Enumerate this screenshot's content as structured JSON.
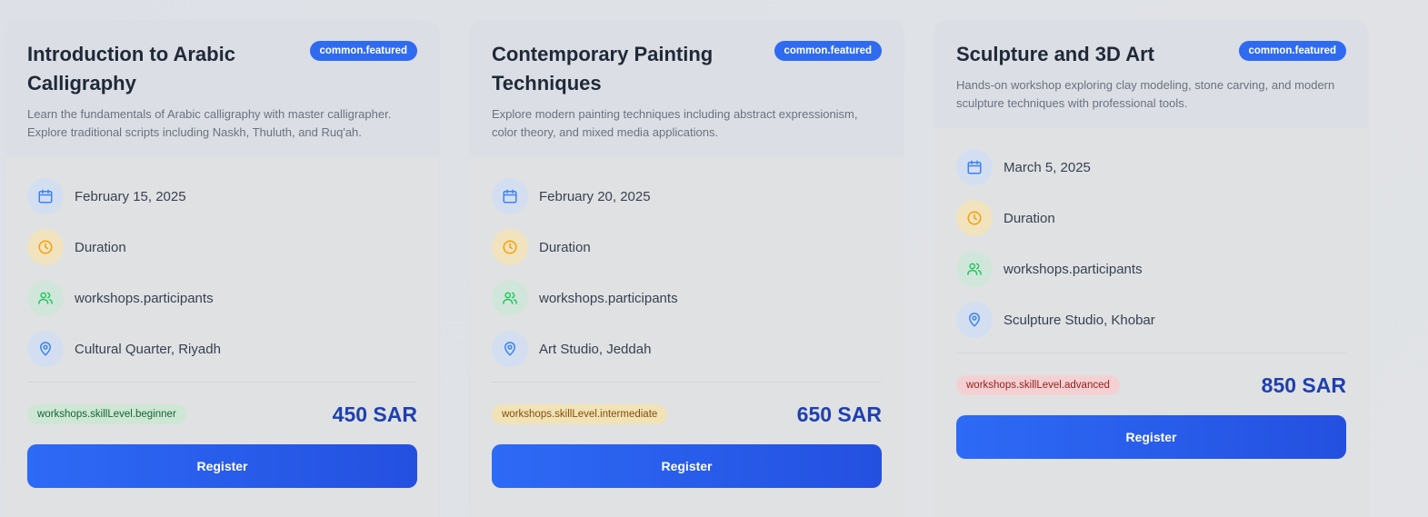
{
  "colors": {
    "accent": "#2f6bf0",
    "price": "#1e40af",
    "icon_blue": "#3b82f6",
    "icon_yellow": "#f59e0b",
    "icon_green": "#22c55e"
  },
  "cards": [
    {
      "title": "Introduction to Arabic Calligraphy",
      "badge": "common.featured",
      "description": "Learn the fundamentals of Arabic calligraphy with master calligrapher. Explore traditional scripts including Naskh, Thuluth, and Ruq'ah.",
      "date": "February 15, 2025",
      "duration": "Duration",
      "participants": "workshops.participants",
      "location": "Cultural Quarter, Riyadh",
      "level": "workshops.skillLevel.beginner",
      "price": "450 SAR",
      "register_label": "Register"
    },
    {
      "title": "Contemporary Painting Techniques",
      "badge": "common.featured",
      "description": "Explore modern painting techniques including abstract expressionism, color theory, and mixed media applications.",
      "date": "February 20, 2025",
      "duration": "Duration",
      "participants": "workshops.participants",
      "location": "Art Studio, Jeddah",
      "level": "workshops.skillLevel.intermediate",
      "price": "650 SAR",
      "register_label": "Register"
    },
    {
      "title": "Sculpture and 3D Art",
      "badge": "common.featured",
      "description": "Hands-on workshop exploring clay modeling, stone carving, and modern sculpture techniques with professional tools.",
      "date": "March 5, 2025",
      "duration": "Duration",
      "participants": "workshops.participants",
      "location": "Sculpture Studio, Khobar",
      "level": "workshops.skillLevel.advanced",
      "price": "850 SAR",
      "register_label": "Register"
    }
  ]
}
